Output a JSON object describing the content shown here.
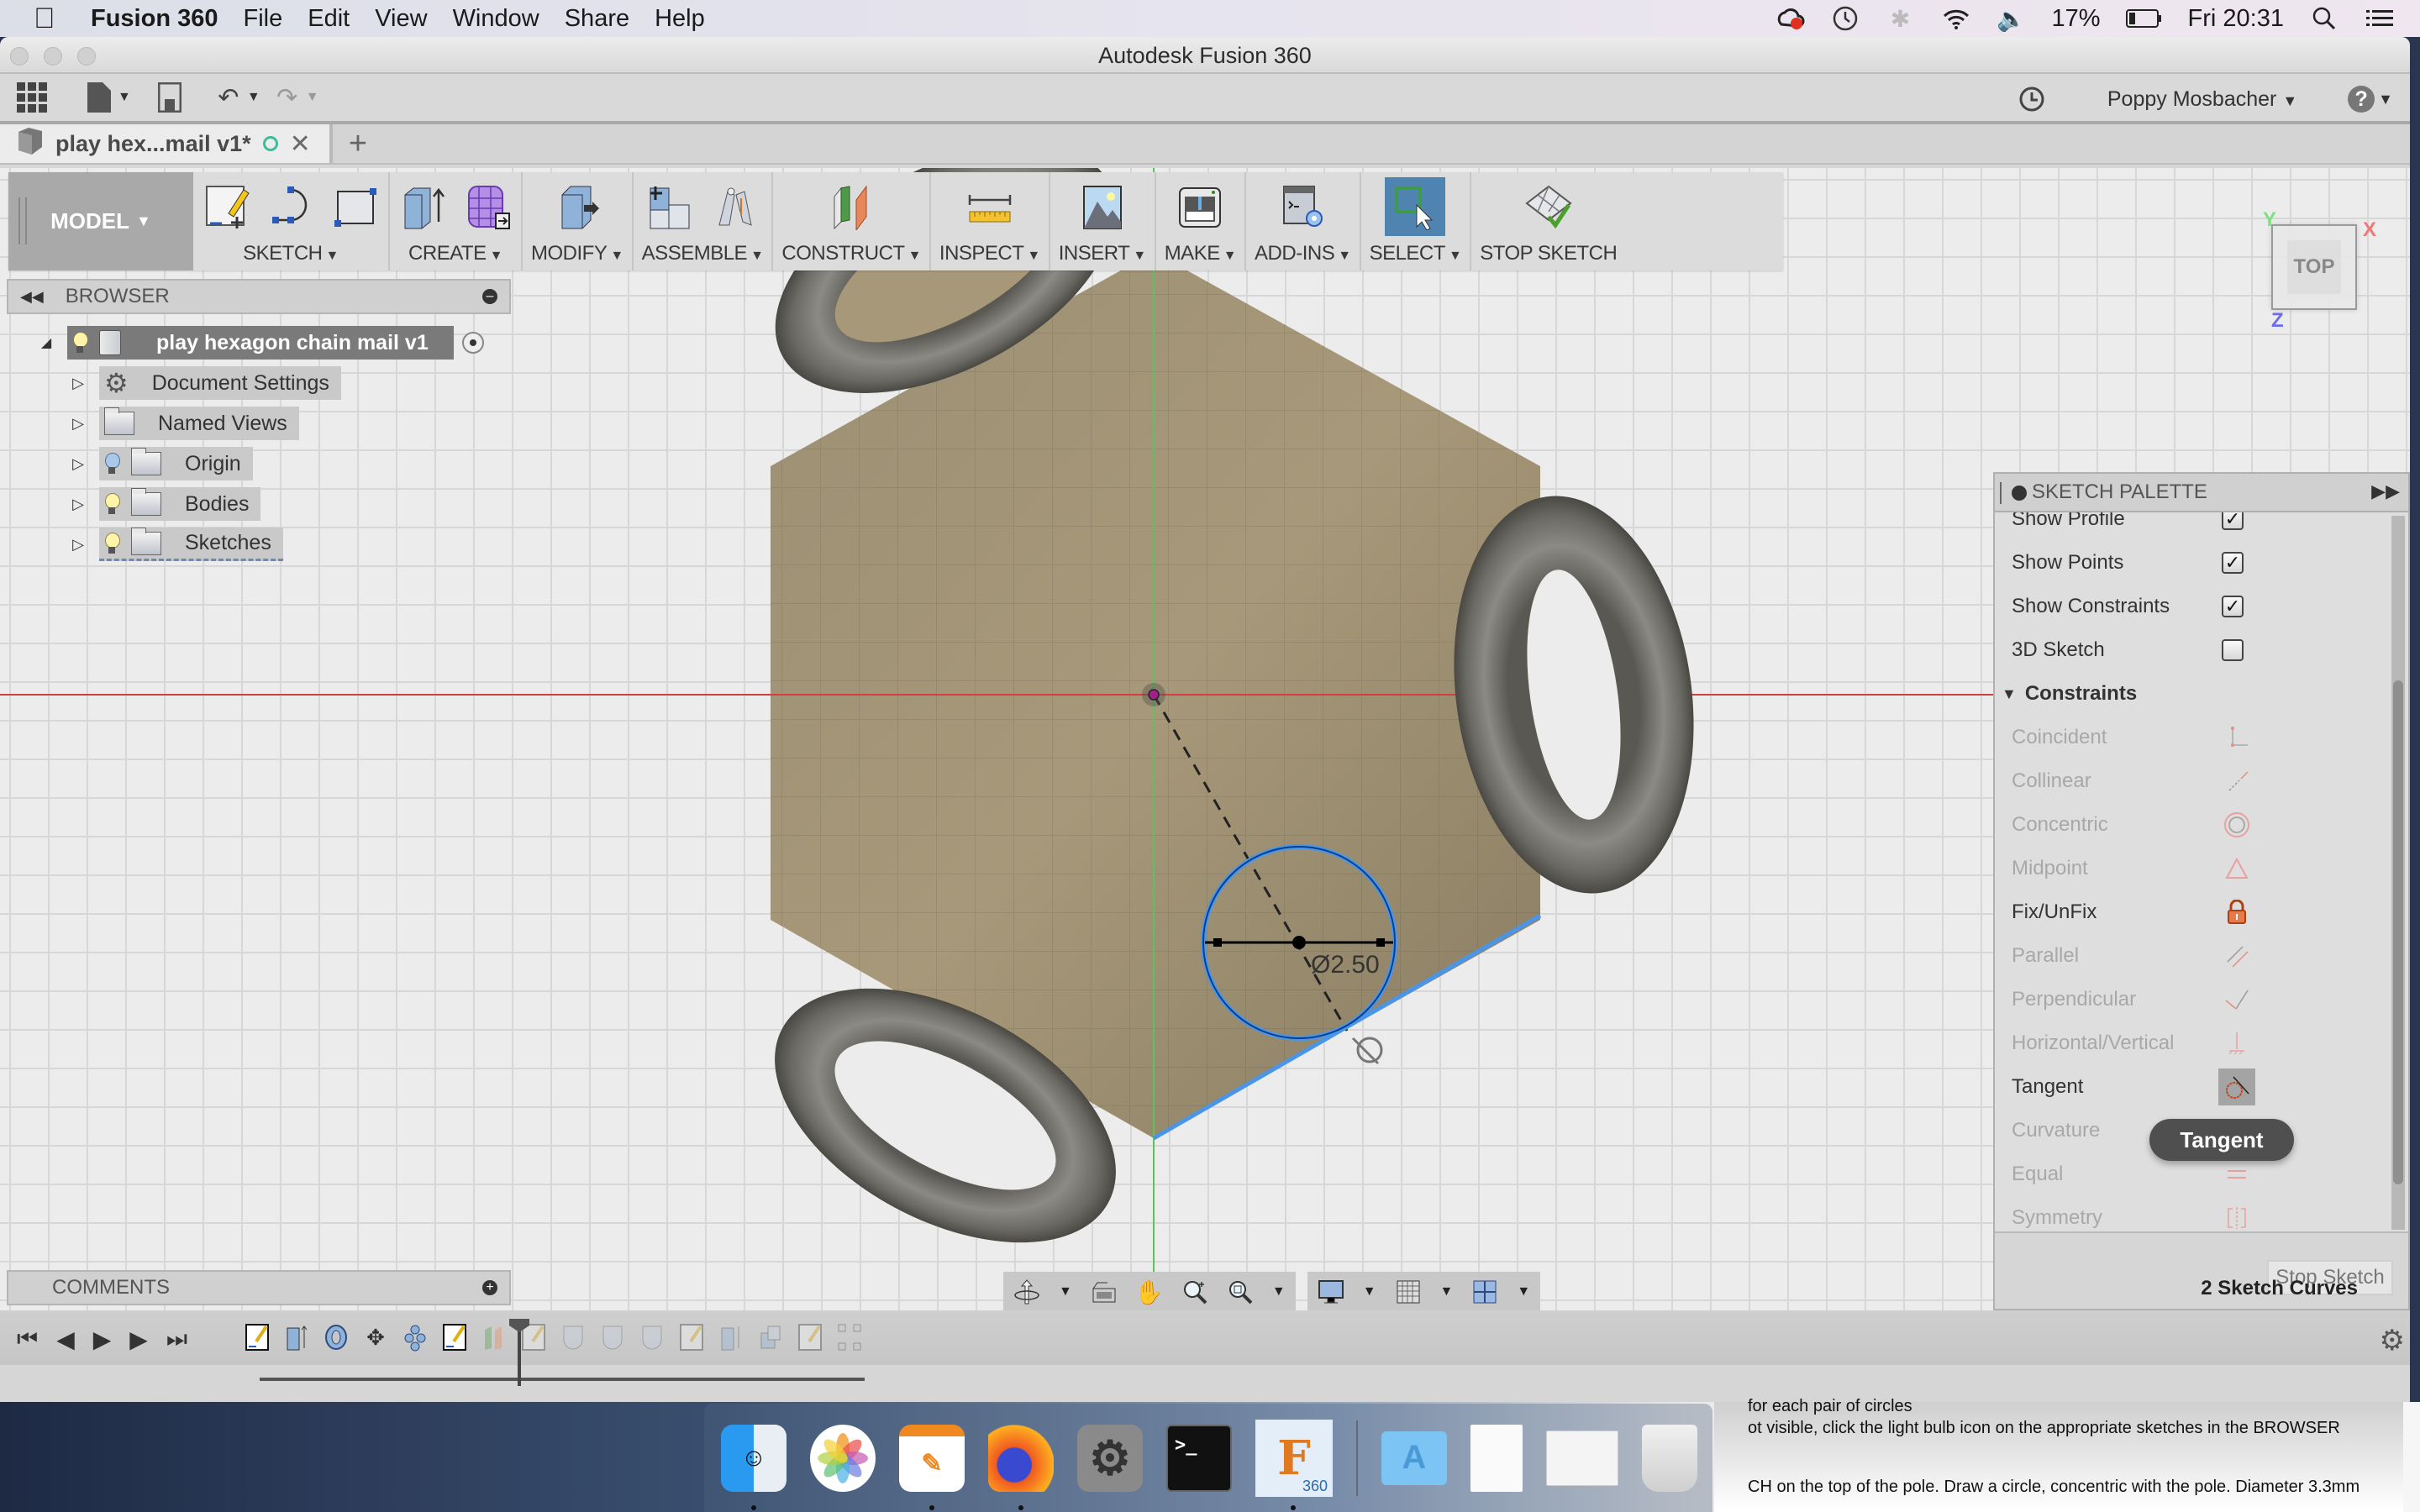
{
  "menubar": {
    "app_name": "Fusion 360",
    "items": [
      "File",
      "Edit",
      "View",
      "Window",
      "Share",
      "Help"
    ],
    "status": {
      "battery_percent": "17%",
      "clock": "Fri 20:31"
    },
    "status_icons": [
      "creative-cloud-icon",
      "time-machine-icon",
      "bluetooth-icon",
      "wifi-icon",
      "volume-icon",
      "battery-icon",
      "spotlight-search-icon",
      "notification-center-icon"
    ]
  },
  "window": {
    "title": "Autodesk Fusion 360"
  },
  "quickbar": {
    "user_name": "Poppy Mosbacher",
    "help_label": "?"
  },
  "tabs": [
    {
      "label": "play hex...mail v1*",
      "active": true
    }
  ],
  "ribbon": {
    "workspace": "MODEL",
    "groups": [
      {
        "label": "SKETCH",
        "has_menu": true
      },
      {
        "label": "CREATE",
        "has_menu": true
      },
      {
        "label": "MODIFY",
        "has_menu": true
      },
      {
        "label": "ASSEMBLE",
        "has_menu": true
      },
      {
        "label": "CONSTRUCT",
        "has_menu": true
      },
      {
        "label": "INSPECT",
        "has_menu": true
      },
      {
        "label": "INSERT",
        "has_menu": true
      },
      {
        "label": "MAKE",
        "has_menu": true
      },
      {
        "label": "ADD-INS",
        "has_menu": true
      },
      {
        "label": "SELECT",
        "has_menu": true
      },
      {
        "label": "STOP SKETCH",
        "has_menu": false
      }
    ]
  },
  "browser": {
    "title": "BROWSER",
    "root": "play hexagon chain mail v1",
    "items": [
      {
        "label": "Document Settings",
        "icon": "gear-icon",
        "bulb": null
      },
      {
        "label": "Named Views",
        "icon": "folder-icon",
        "bulb": null
      },
      {
        "label": "Origin",
        "icon": "folder-icon",
        "bulb": "off"
      },
      {
        "label": "Bodies",
        "icon": "folder-icon",
        "bulb": "on"
      },
      {
        "label": "Sketches",
        "icon": "folder-icon",
        "bulb": "on"
      }
    ]
  },
  "viewcube": {
    "face": "TOP",
    "axes": {
      "x": "X",
      "y": "Y",
      "z": "Z"
    }
  },
  "sketch": {
    "dimension": "Ø2.50"
  },
  "palette": {
    "title": "SKETCH PALETTE",
    "options": [
      {
        "label": "Show Profile",
        "checked": true
      },
      {
        "label": "Show Points",
        "checked": true
      },
      {
        "label": "Show Constraints",
        "checked": true
      },
      {
        "label": "3D Sketch",
        "checked": false
      }
    ],
    "constraints_title": "Constraints",
    "constraints": [
      {
        "label": "Coincident",
        "enabled": false,
        "icon": "coincident-icon"
      },
      {
        "label": "Collinear",
        "enabled": false,
        "icon": "collinear-icon"
      },
      {
        "label": "Concentric",
        "enabled": false,
        "icon": "concentric-icon"
      },
      {
        "label": "Midpoint",
        "enabled": false,
        "icon": "midpoint-icon"
      },
      {
        "label": "Fix/UnFix",
        "enabled": true,
        "icon": "lock-icon"
      },
      {
        "label": "Parallel",
        "enabled": false,
        "icon": "parallel-icon"
      },
      {
        "label": "Perpendicular",
        "enabled": false,
        "icon": "perpendicular-icon"
      },
      {
        "label": "Horizontal/Vertical",
        "enabled": false,
        "icon": "horizontal-vertical-icon"
      },
      {
        "label": "Tangent",
        "enabled": true,
        "icon": "tangent-icon",
        "hovered": true
      },
      {
        "label": "Curvature",
        "enabled": false,
        "icon": "curvature-icon"
      },
      {
        "label": "Equal",
        "enabled": false,
        "icon": "equal-icon"
      },
      {
        "label": "Symmetry",
        "enabled": false,
        "icon": "symmetry-icon"
      }
    ],
    "stop_sketch_label": "Stop Sketch",
    "selection_count": "2 Sketch Curves",
    "tooltip": "Tangent"
  },
  "comments": {
    "title": "COMMENTS"
  },
  "background_document": {
    "lines": [
      "for each pair of circles",
      "ot visible, click the light bulb icon on the appropriate sketches in the BROWSER",
      "CH on the top of the pole. Draw a circle, concentric with the pole. Diameter 3.3mm"
    ]
  },
  "dock": {
    "apps": [
      "Finder",
      "Photos",
      "Pages",
      "Firefox",
      "System Preferences",
      "Terminal",
      "Fusion 360"
    ],
    "running": [
      "Finder",
      "Pages",
      "Firefox",
      "Fusion 360"
    ],
    "right_items": [
      "Applications",
      "Document",
      "Pages Document",
      "Trash"
    ],
    "fusion_badge": "360"
  },
  "colors": {
    "selection_blue": "#2f7fd6",
    "sketch_dark_blue": "#0a3f8c",
    "x_axis": "#d04040",
    "y_axis": "#4ac24a",
    "body_tan": "#a59678",
    "active_select": "#4f84b0"
  }
}
